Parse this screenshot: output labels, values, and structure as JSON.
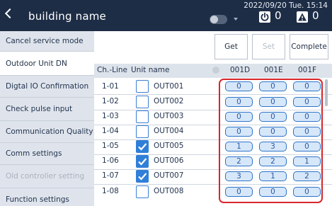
{
  "header": {
    "title": "building name",
    "datetime": "2022/09/20 Tue. 15:14",
    "power_count": "0",
    "alert_count": "0"
  },
  "sidebar": {
    "items": [
      {
        "label": "Cancel service mode",
        "state": "normal"
      },
      {
        "label": "Outdoor Unit DN",
        "state": "active"
      },
      {
        "label": "Digtal IO Confirmation",
        "state": "normal"
      },
      {
        "label": "Check pulse input",
        "state": "normal"
      },
      {
        "label": "Communication Quality",
        "state": "normal"
      },
      {
        "label": "Comm settings",
        "state": "normal"
      },
      {
        "label": "Old controller setting",
        "state": "disabled"
      },
      {
        "label": "Function settings",
        "state": "normal"
      }
    ]
  },
  "actions": {
    "get": "Get",
    "set": "Set",
    "complete": "Complete"
  },
  "table": {
    "headers": {
      "ch_line": "Ch.-Line",
      "unit_name": "Unit name",
      "col1": "001D",
      "col2": "001E",
      "col3": "001F"
    },
    "rows": [
      {
        "ch": "1-01",
        "checked": false,
        "name": "OUT001",
        "v": [
          "0",
          "0",
          "0"
        ]
      },
      {
        "ch": "1-02",
        "checked": false,
        "name": "OUT002",
        "v": [
          "0",
          "0",
          "0"
        ]
      },
      {
        "ch": "1-03",
        "checked": false,
        "name": "OUT003",
        "v": [
          "0",
          "0",
          "0"
        ]
      },
      {
        "ch": "1-04",
        "checked": false,
        "name": "OUT004",
        "v": [
          "0",
          "0",
          "0"
        ]
      },
      {
        "ch": "1-05",
        "checked": true,
        "name": "OUT005",
        "v": [
          "1",
          "3",
          "0"
        ]
      },
      {
        "ch": "1-06",
        "checked": true,
        "name": "OUT006",
        "v": [
          "2",
          "2",
          "1"
        ]
      },
      {
        "ch": "1-07",
        "checked": true,
        "name": "OUT007",
        "v": [
          "3",
          "1",
          "2"
        ]
      },
      {
        "ch": "1-08",
        "checked": false,
        "name": "OUT008",
        "v": [
          "0",
          "0",
          "0"
        ]
      }
    ]
  },
  "colors": {
    "header_bg": "#1e2d46",
    "sidebar_bg": "#dfe4ec",
    "accent_blue": "#2f7fd8",
    "value_fill": "#d6e7fa",
    "highlight_red": "#d9252a"
  },
  "icons": [
    "back-chevron-icon",
    "toggle-icon",
    "dropdown-arrow-icon",
    "power-icon",
    "alert-icon",
    "checkbox-icon",
    "checkmark-icon",
    "scroll-handle-icon"
  ]
}
